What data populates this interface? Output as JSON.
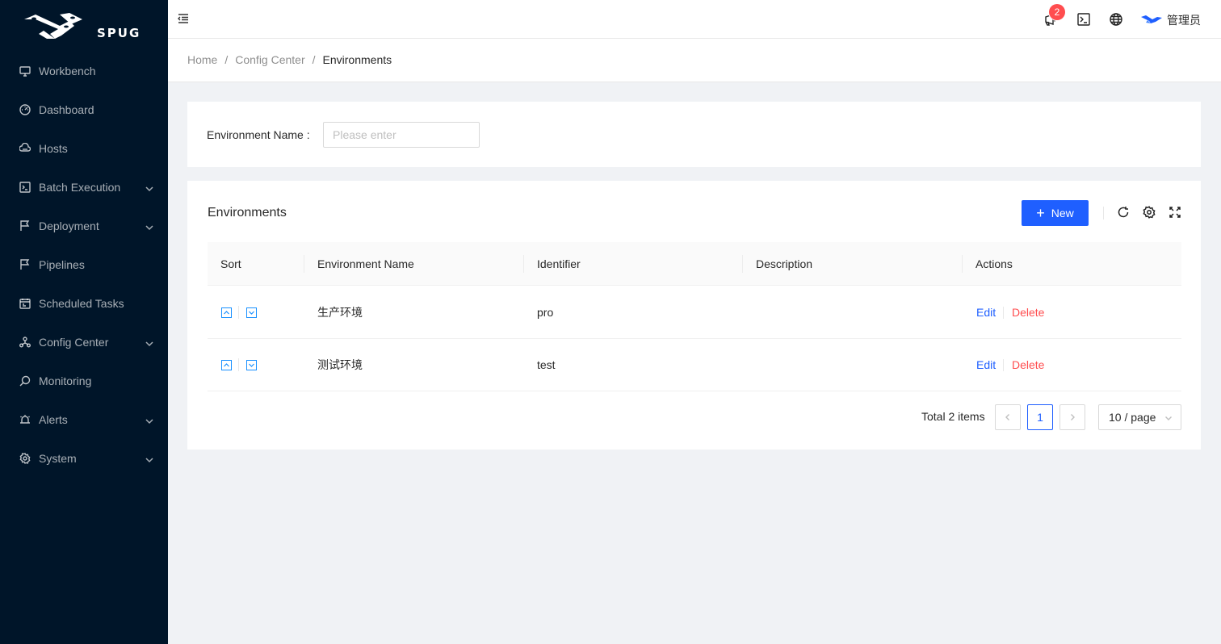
{
  "app": {
    "logo_text": "SPUG"
  },
  "sidebar": {
    "items": [
      {
        "label": "Workbench",
        "icon": "desktop-icon",
        "has_submenu": false
      },
      {
        "label": "Dashboard",
        "icon": "dashboard-icon",
        "has_submenu": false
      },
      {
        "label": "Hosts",
        "icon": "cloud-server-icon",
        "has_submenu": false
      },
      {
        "label": "Batch Execution",
        "icon": "code-icon",
        "has_submenu": true
      },
      {
        "label": "Deployment",
        "icon": "flag-icon",
        "has_submenu": true
      },
      {
        "label": "Pipelines",
        "icon": "flag-icon",
        "has_submenu": false
      },
      {
        "label": "Scheduled Tasks",
        "icon": "schedule-icon",
        "has_submenu": false
      },
      {
        "label": "Config Center",
        "icon": "deployment-unit-icon",
        "has_submenu": true
      },
      {
        "label": "Monitoring",
        "icon": "monitor-search-icon",
        "has_submenu": false
      },
      {
        "label": "Alerts",
        "icon": "alarm-icon",
        "has_submenu": true
      },
      {
        "label": "System",
        "icon": "setting-icon",
        "has_submenu": true
      }
    ]
  },
  "header": {
    "notification_count": "2",
    "username": "管理员"
  },
  "breadcrumb": [
    "Home",
    "Config Center",
    "Environments"
  ],
  "search": {
    "label": "Environment Name",
    "placeholder": "Please enter",
    "value": ""
  },
  "table": {
    "title": "Environments",
    "new_label": "New",
    "columns": [
      "Sort",
      "Environment Name",
      "Identifier",
      "Description",
      "Actions"
    ],
    "rows": [
      {
        "name": "生产环境",
        "identifier": "pro",
        "description": "",
        "edit": "Edit",
        "delete": "Delete"
      },
      {
        "name": "测试环境",
        "identifier": "test",
        "description": "",
        "edit": "Edit",
        "delete": "Delete"
      }
    ]
  },
  "pagination": {
    "total_text": "Total 2 items",
    "current_page": "1",
    "page_size": "10 / page"
  },
  "colors": {
    "primary": "#1f5fff",
    "danger": "#ff4d4f",
    "sidebar_bg": "#001529"
  }
}
